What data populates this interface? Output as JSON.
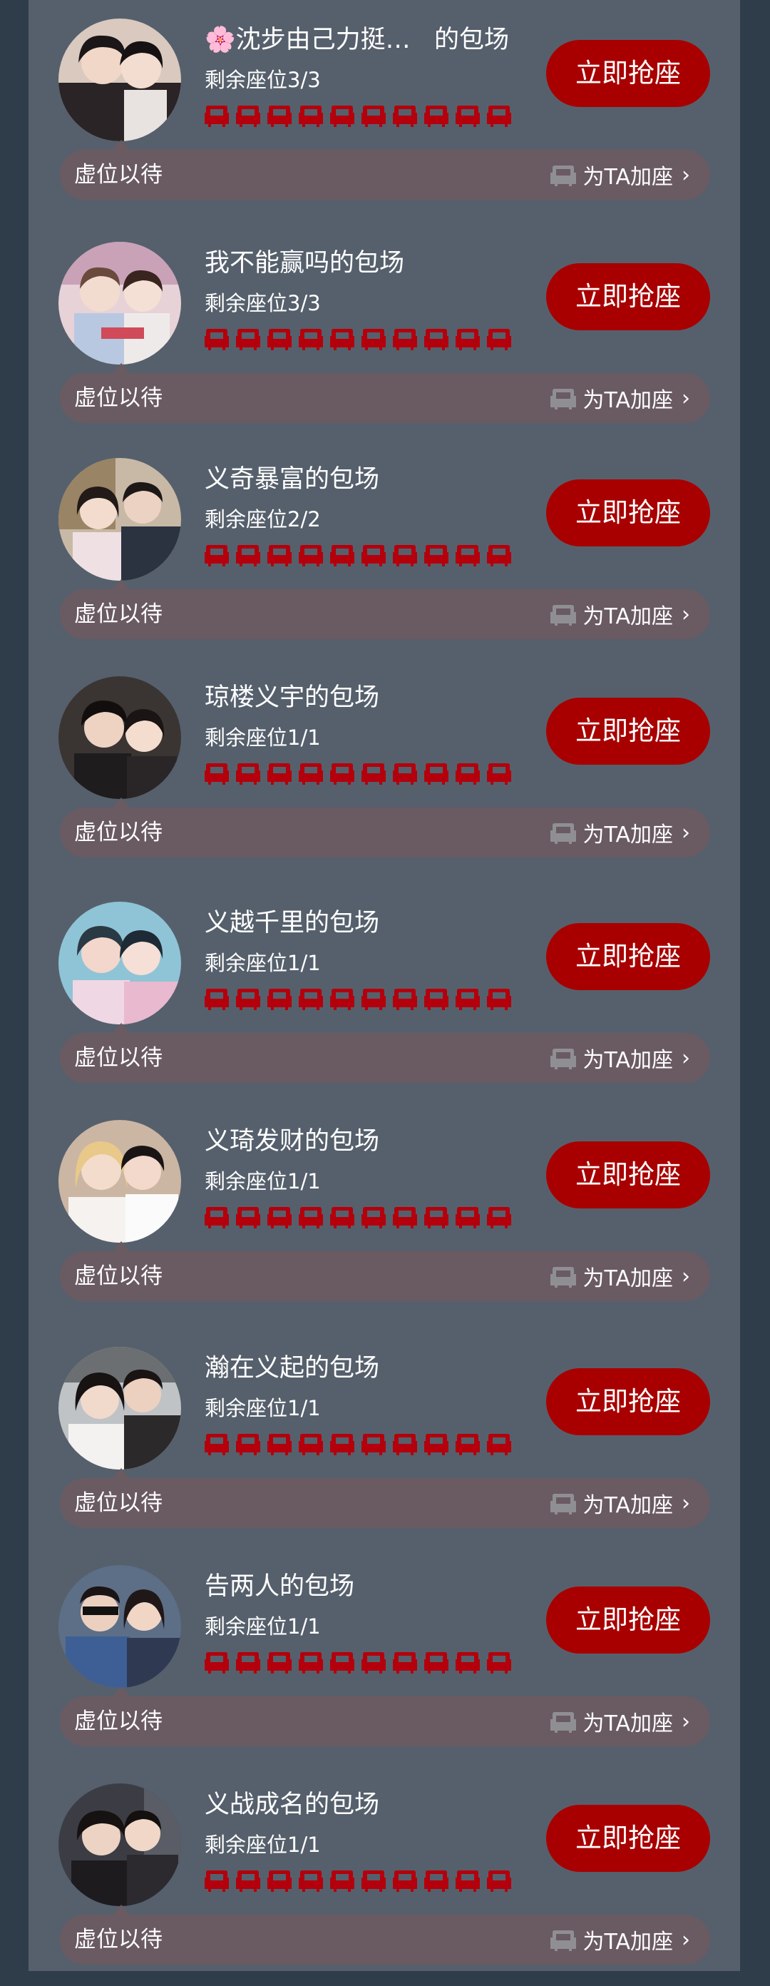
{
  "colors": {
    "page_bg": "#2f3d4b",
    "panel_bg": "#56606c",
    "button_red": "#a80000",
    "seat_red": "#b3000c",
    "bar_bg": "#6a5a62"
  },
  "common": {
    "grab_label": "立即抢座",
    "waiting_text": "虚位以待",
    "add_seat_label": "为TA加座",
    "chevron": "›",
    "seat_icon": "sofa-icon",
    "seats_per_row": 10
  },
  "rooms": [
    {
      "title": "🌸沈步由己力挺…   的包场",
      "seats_text": "剩余座位3/3"
    },
    {
      "title": "我不能赢吗的包场",
      "seats_text": "剩余座位3/3"
    },
    {
      "title": "义奇暴富的包场",
      "seats_text": "剩余座位2/2"
    },
    {
      "title": "琼楼义宇的包场",
      "seats_text": "剩余座位1/1"
    },
    {
      "title": "义越千里的包场",
      "seats_text": "剩余座位1/1"
    },
    {
      "title": "义琦发财的包场",
      "seats_text": "剩余座位1/1"
    },
    {
      "title": "瀚在义起的包场",
      "seats_text": "剩余座位1/1"
    },
    {
      "title": "告两人的包场",
      "seats_text": "剩余座位1/1"
    },
    {
      "title": "义战成名的包场",
      "seats_text": "剩余座位1/1"
    }
  ]
}
